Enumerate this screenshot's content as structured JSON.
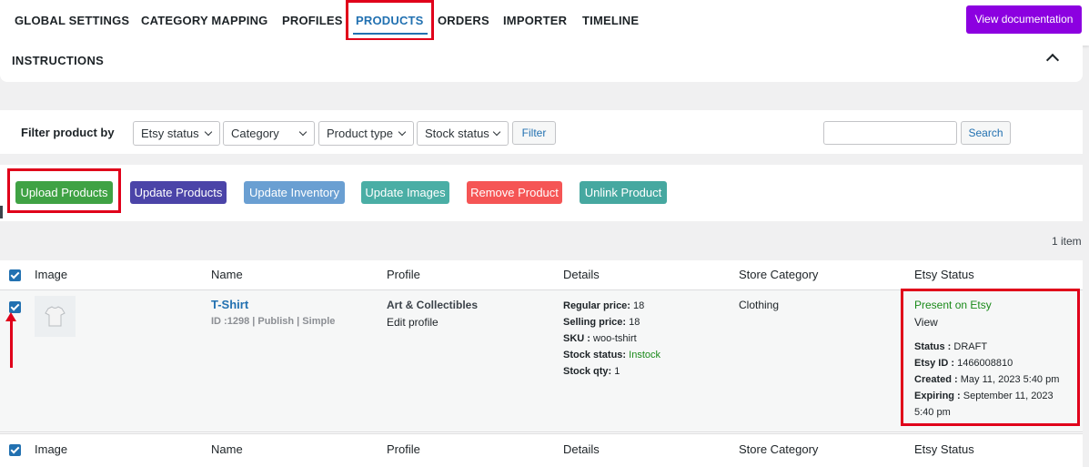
{
  "nav": {
    "items": [
      "GLOBAL SETTINGS",
      "CATEGORY MAPPING",
      "PROFILES",
      "PRODUCTS",
      "ORDERS",
      "IMPORTER",
      "TIMELINE"
    ],
    "active": "PRODUCTS",
    "doc_button": "View documentation"
  },
  "instructions": {
    "title": "INSTRUCTIONS"
  },
  "filter": {
    "label": "Filter product by",
    "selects": [
      "Etsy status",
      "Category",
      "Product type",
      "Stock status"
    ],
    "filter_button": "Filter",
    "search_button": "Search",
    "search_value": ""
  },
  "actions": {
    "upload": "Upload Products",
    "update_products": "Update Products",
    "update_inventory": "Update Inventory",
    "update_images": "Update Images",
    "remove": "Remove Product",
    "unlink": "Unlink Product"
  },
  "count": "1 item",
  "table": {
    "headers": [
      "Image",
      "Name",
      "Profile",
      "Details",
      "Store Category",
      "Etsy Status"
    ],
    "row": {
      "name": "T-Shirt",
      "meta": "ID :1298 | Publish | Simple",
      "profile": "Art & Collectibles",
      "edit_profile": "Edit profile",
      "regular_price_label": "Regular price:",
      "regular_price": "18",
      "selling_price_label": "Selling price:",
      "selling_price": "18",
      "sku_label": "SKU :",
      "sku": "woo-tshirt",
      "stock_status_label": "Stock status:",
      "stock_status": "Instock",
      "stock_qty_label": "Stock qty:",
      "stock_qty": "1",
      "store_category": "Clothing",
      "etsy_present": "Present on Etsy",
      "etsy_view": "View",
      "status_label": "Status :",
      "status": "DRAFT",
      "etsy_id_label": "Etsy ID :",
      "etsy_id": "1466008810",
      "created_label": "Created :",
      "created": "May 11, 2023 5:40 pm",
      "expiring_label": "Expiring :",
      "expiring": "September 11, 2023",
      "expiring_time": "5:40 pm"
    }
  },
  "colors": {
    "primary": "#2271b1",
    "upload": "#3fa244",
    "update_products": "#4b44a8",
    "update_inventory": "#6a9fd2",
    "update_images": "#4aaea5",
    "remove": "#f55555",
    "unlink": "#46a8a0",
    "highlight": "#e0001a",
    "doc_button": "#8c00e0"
  }
}
